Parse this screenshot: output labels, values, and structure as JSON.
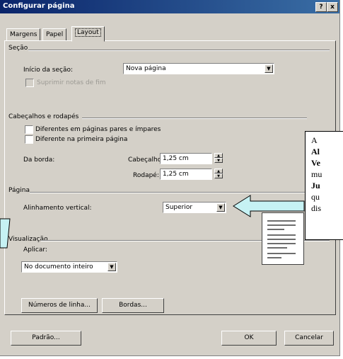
{
  "title": "Configurar página",
  "window_buttons": {
    "help": "?",
    "close": "x"
  },
  "tabs": [
    {
      "label": "Margens",
      "active": false
    },
    {
      "label": "Papel",
      "active": false
    },
    {
      "label": "Layout",
      "active": true
    }
  ],
  "section": {
    "heading": "Seção",
    "start_label": "Início da seção:",
    "start_value": "Nova página",
    "suppress_label": "Suprimir notas de fim"
  },
  "headers": {
    "heading": "Cabeçalhos e rodapés",
    "odd_even_label": "Diferentes em páginas pares e ímpares",
    "first_page_label": "Diferente na primeira página",
    "from_edge_label": "Da borda:",
    "header_label": "Cabeçalho:",
    "header_value": "1,25 cm",
    "footer_label": "Rodapé:",
    "footer_value": "1,25 cm"
  },
  "page": {
    "heading": "Página",
    "valign_label": "Alinhamento vertical:",
    "valign_value": "Superior"
  },
  "preview": {
    "heading": "Visualização",
    "apply_label": "Aplicar:",
    "apply_value": "No documento inteiro"
  },
  "buttons": {
    "line_numbers": "Números de linha...",
    "borders": "Bordas...",
    "default": "Padrão...",
    "ok": "OK",
    "cancel": "Cancelar"
  },
  "callout": {
    "line1": "A",
    "line2": "Al",
    "line3": "Ve",
    "line4": "mu",
    "line5": "Ju",
    "line6": "qu",
    "line7": "dis"
  },
  "colors": {
    "titlebar": "#0a246a",
    "dialog": "#d4d0c8",
    "arrow_fill": "#c6f2f4"
  }
}
